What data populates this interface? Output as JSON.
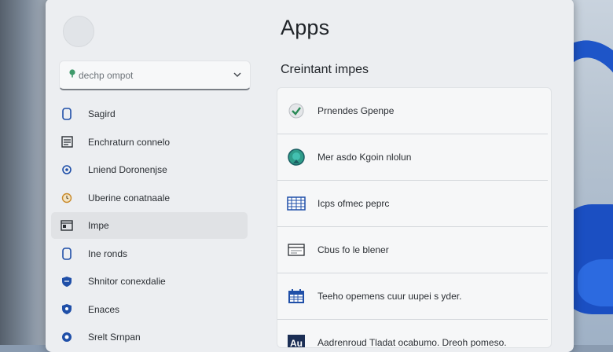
{
  "window": {
    "title": "Apps"
  },
  "search": {
    "placeholder": "dechp ompot"
  },
  "sidebar": {
    "items": [
      {
        "label": "Sagird",
        "icon": "phone-icon",
        "selected": false
      },
      {
        "label": "Enchraturn connelo",
        "icon": "calendar-icon",
        "selected": false
      },
      {
        "label": "Lniend Doronenjse",
        "icon": "globe-icon",
        "selected": false
      },
      {
        "label": "Uberine conatnaale",
        "icon": "clock-icon",
        "selected": false
      },
      {
        "label": "Impe",
        "icon": "window-icon",
        "selected": true
      },
      {
        "label": "Ine ronds",
        "icon": "phone-icon",
        "selected": false
      },
      {
        "label": "Shnitor conexdalie",
        "icon": "shield-icon",
        "selected": false
      },
      {
        "label": "Enaces",
        "icon": "shield-icon",
        "selected": false
      },
      {
        "label": "Srelt Srnpan",
        "icon": "globe-icon",
        "selected": false
      }
    ]
  },
  "main": {
    "section_title": "Creintant impes",
    "rows": [
      {
        "label": "Prnendes Gpenpe",
        "icon": "check-shield-icon"
      },
      {
        "label": "Mer asdo Kgoin nlolun",
        "icon": "globe-app-icon"
      },
      {
        "label": "Icps ofmec peprc",
        "icon": "grid-app-icon"
      },
      {
        "label": "Cbus fo le blener",
        "icon": "window-app-icon"
      },
      {
        "label": "Teeho opemens cuur uupei s yder.",
        "icon": "calendar-app-icon"
      },
      {
        "label": "Aadrenroud Tladat ocabumo. Dreoh pomeso.",
        "icon": "au-app-icon",
        "badge": "Au"
      }
    ]
  },
  "colors": {
    "accent": "#1e55c8",
    "window_bg": "#eceef1",
    "selected_bg": "#e0e2e5"
  }
}
